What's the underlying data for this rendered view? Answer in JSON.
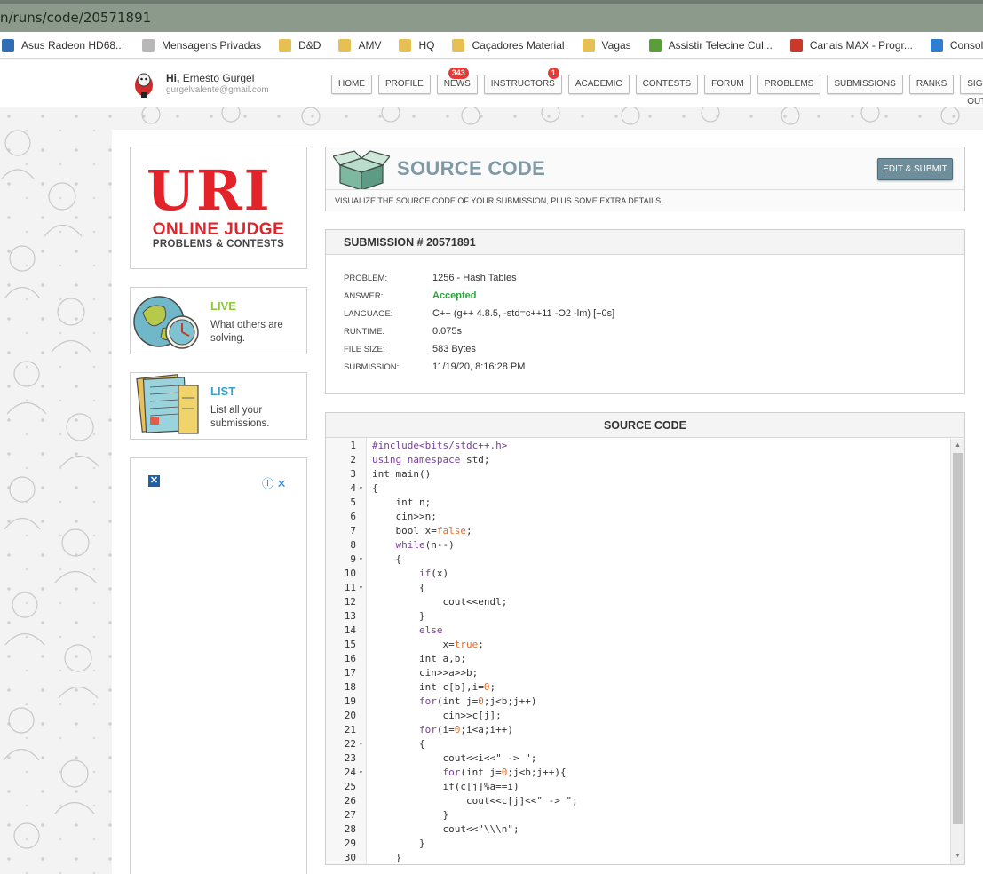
{
  "browser": {
    "url": "n/runs/code/20571891",
    "bookmarks": [
      {
        "label": "Asus Radeon HD68...",
        "color": "#2f6db5"
      },
      {
        "label": "Mensagens Privadas",
        "color": "#b8b8b8"
      },
      {
        "label": "D&D",
        "color": "#e6c052"
      },
      {
        "label": "AMV",
        "color": "#e6c052"
      },
      {
        "label": "HQ",
        "color": "#e6c052"
      },
      {
        "label": "Caçadores Material",
        "color": "#e6c052"
      },
      {
        "label": "Vagas",
        "color": "#e6c052"
      },
      {
        "label": "Assistir Telecine Cul...",
        "color": "#5a9e3a"
      },
      {
        "label": "Canais MAX - Progr...",
        "color": "#c8392b"
      },
      {
        "label": "Consola | Ate",
        "color": "#2f7fd1"
      }
    ]
  },
  "user": {
    "greeting_hi": "Hi,",
    "name": "Ernesto Gurgel",
    "email": "gurgelvalente@gmail.com"
  },
  "nav": {
    "items": [
      "HOME",
      "PROFILE",
      "NEWS",
      "INSTRUCTORS",
      "ACADEMIC",
      "CONTESTS",
      "FORUM",
      "PROBLEMS",
      "SUBMISSIONS",
      "RANKS",
      "SIGN OUT"
    ],
    "news_badge": "343",
    "instructors_badge": "1"
  },
  "logo": {
    "uri": "URI",
    "online_judge": "ONLINE JUDGE",
    "tagline": "PROBLEMS & CONTESTS"
  },
  "side": {
    "live_title": "LIVE",
    "live_desc": "What others are solving.",
    "list_title": "LIST",
    "list_desc": "List all your submissions."
  },
  "ad": {
    "close": "✕",
    "info": "ⓘ ✕"
  },
  "source_header": {
    "title": "SOURCE CODE",
    "button": "EDIT & SUBMIT",
    "subtitle": "VISUALIZE THE SOURCE CODE OF YOUR SUBMISSION, PLUS SOME EXTRA DETAILS."
  },
  "submission": {
    "heading": "SUBMISSION # 20571891",
    "fields": [
      {
        "key": "PROBLEM:",
        "value": "1256 - Hash Tables"
      },
      {
        "key": "ANSWER:",
        "value": "Accepted"
      },
      {
        "key": "LANGUAGE:",
        "value": "C++ (g++ 4.8.5, -std=c++11 -O2 -lm) [+0s]"
      },
      {
        "key": "RUNTIME:",
        "value": "0.075s"
      },
      {
        "key": "FILE SIZE:",
        "value": "583 Bytes"
      },
      {
        "key": "SUBMISSION:",
        "value": "11/19/20, 8:16:28 PM"
      }
    ]
  },
  "code": {
    "heading": "SOURCE CODE",
    "lines": [
      {
        "n": "1",
        "fold": "",
        "html": "<span class=\"kw\">#include&lt;bits/stdc++.h&gt;</span>"
      },
      {
        "n": "2",
        "fold": "",
        "html": "<span class=\"kw\">using namespace</span> std;"
      },
      {
        "n": "3",
        "fold": "",
        "html": "int main()"
      },
      {
        "n": "4",
        "fold": "▾",
        "html": "{"
      },
      {
        "n": "5",
        "fold": "",
        "html": "    int n;"
      },
      {
        "n": "6",
        "fold": "",
        "html": "    cin&gt;&gt;n;"
      },
      {
        "n": "7",
        "fold": "",
        "html": "    bool x=<span class=\"num\">false</span>;"
      },
      {
        "n": "8",
        "fold": "",
        "html": "    <span class=\"kw\">while</span>(n--)"
      },
      {
        "n": "9",
        "fold": "▾",
        "html": "    {"
      },
      {
        "n": "10",
        "fold": "",
        "html": "        <span class=\"kw\">if</span>(x)"
      },
      {
        "n": "11",
        "fold": "▾",
        "html": "        {"
      },
      {
        "n": "12",
        "fold": "",
        "html": "            cout&lt;&lt;endl;"
      },
      {
        "n": "13",
        "fold": "",
        "html": "        }"
      },
      {
        "n": "14",
        "fold": "",
        "html": "        <span class=\"kw\">else</span>"
      },
      {
        "n": "15",
        "fold": "",
        "html": "            x=<span class=\"num\">true</span>;"
      },
      {
        "n": "16",
        "fold": "",
        "html": "        int a,b;"
      },
      {
        "n": "17",
        "fold": "",
        "html": "        cin&gt;&gt;a&gt;&gt;b;"
      },
      {
        "n": "18",
        "fold": "",
        "html": "        int c[b],i=<span class=\"num\">0</span>;"
      },
      {
        "n": "19",
        "fold": "",
        "html": "        <span class=\"kw\">for</span>(int j=<span class=\"num\">0</span>;j&lt;b;j++)"
      },
      {
        "n": "20",
        "fold": "",
        "html": "            cin&gt;&gt;c[j];"
      },
      {
        "n": "21",
        "fold": "",
        "html": "        <span class=\"kw\">for</span>(i=<span class=\"num\">0</span>;i&lt;a;i++)"
      },
      {
        "n": "22",
        "fold": "▾",
        "html": "        {"
      },
      {
        "n": "23",
        "fold": "",
        "html": "            cout&lt;&lt;i&lt;&lt;\" -&gt; \";"
      },
      {
        "n": "24",
        "fold": "▾",
        "html": "            <span class=\"kw\">for</span>(int j=<span class=\"num\">0</span>;j&lt;b;j++){"
      },
      {
        "n": "25",
        "fold": "",
        "html": "            if(c[j]%a==i)"
      },
      {
        "n": "26",
        "fold": "",
        "html": "                cout&lt;&lt;c[j]&lt;&lt;\" -&gt; \";"
      },
      {
        "n": "27",
        "fold": "",
        "html": "            }"
      },
      {
        "n": "28",
        "fold": "",
        "html": "            cout&lt;&lt;\"\\\\\\n\";"
      },
      {
        "n": "29",
        "fold": "",
        "html": "        }"
      },
      {
        "n": "30",
        "fold": "",
        "html": "    }"
      }
    ]
  }
}
